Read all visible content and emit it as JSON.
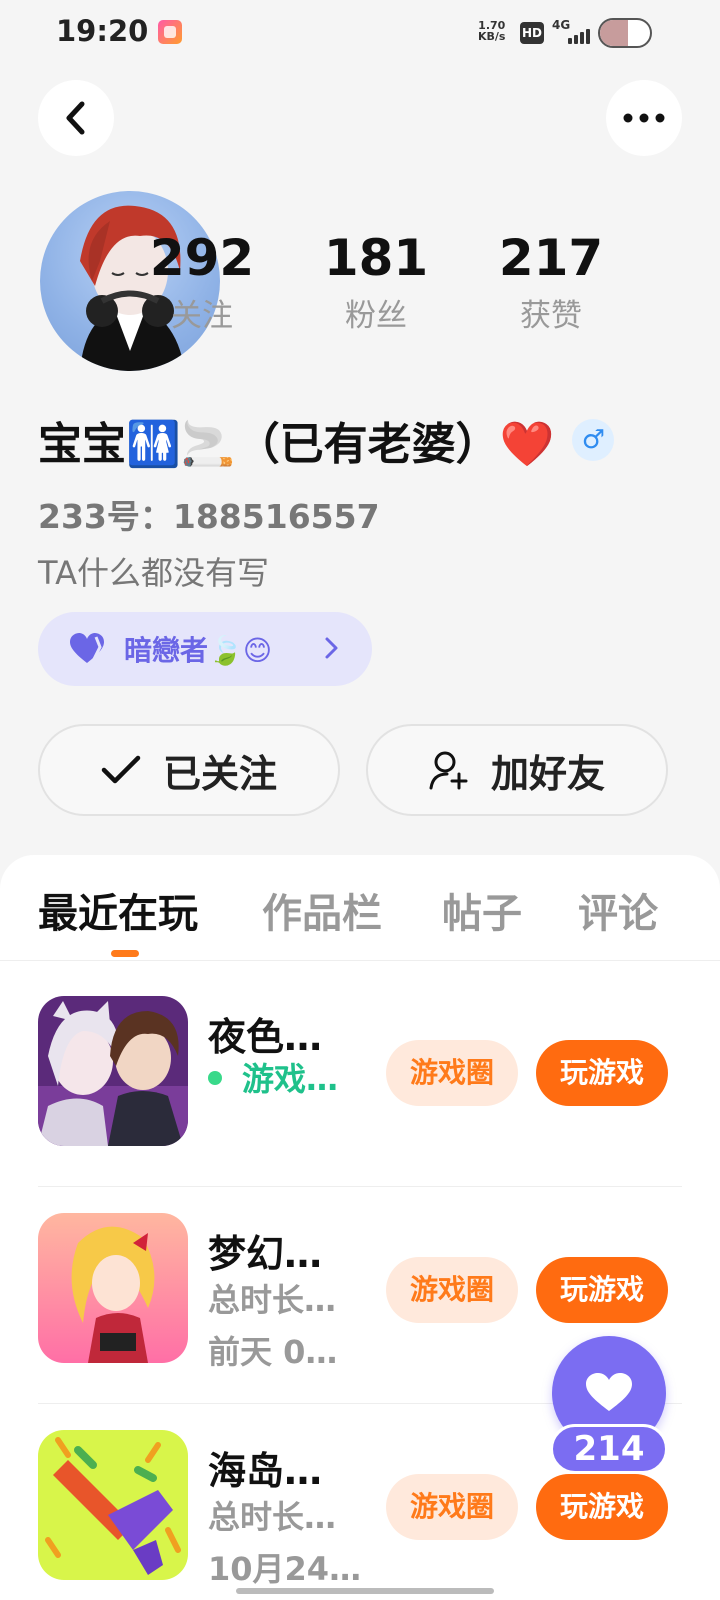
{
  "status_bar": {
    "time": "19:20",
    "net_speed_value": "1.70",
    "net_speed_unit": "KB/s",
    "hd_label": "HD",
    "network": "4G",
    "battery_level": 0.55
  },
  "profile": {
    "stats": [
      {
        "value": "292",
        "label": "关注"
      },
      {
        "value": "181",
        "label": "粉丝"
      },
      {
        "value": "217",
        "label": "获赞"
      }
    ],
    "nickname": "宝宝🚻🚬（已有老婆）❤️",
    "gender_symbol": "♂",
    "user_id": "233号：188516557",
    "bio": "TA什么都没有写",
    "tag": "暗戀者🍃😊"
  },
  "actions": {
    "followed_label": "已关注",
    "add_friend_label": "加好友"
  },
  "tabs": [
    {
      "label": "最近在玩",
      "active": true
    },
    {
      "label": "作品栏",
      "active": false
    },
    {
      "label": "帖子",
      "active": false
    },
    {
      "label": "评论",
      "active": false
    }
  ],
  "games": [
    {
      "name": "夜色…",
      "line1": "游戏…",
      "line2": "",
      "online": true,
      "circle_label": "游戏圈",
      "play_label": "玩游戏"
    },
    {
      "name": "梦幻…",
      "line1": "总时长…",
      "line2": "前天 0…",
      "online": false,
      "circle_label": "游戏圈",
      "play_label": "玩游戏"
    },
    {
      "name": "海岛…",
      "line1": "总时长…",
      "line2": "10月24…",
      "online": false,
      "circle_label": "游戏圈",
      "play_label": "玩游戏"
    }
  ],
  "like_fab": {
    "count": "214"
  },
  "colors": {
    "accent_orange": "#ff6b10",
    "accent_purple": "#7b6df2",
    "online_green": "#1fc18b"
  }
}
